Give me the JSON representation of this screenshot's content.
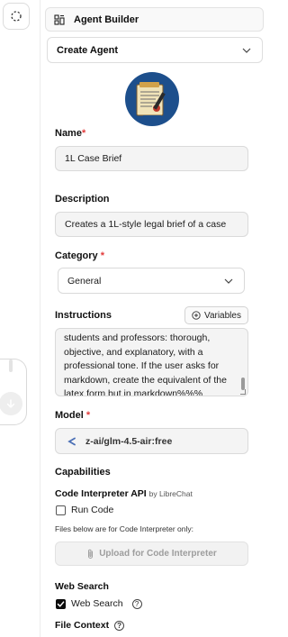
{
  "header": {
    "title": "Agent Builder"
  },
  "agent_select": {
    "value": "Create Agent"
  },
  "avatar": {
    "alt": "CASE BRIEF"
  },
  "name": {
    "label": "Name",
    "required_mark": "*",
    "value": "1L Case Brief"
  },
  "description": {
    "label": "Description",
    "value": "Creates a 1L-style legal brief of a case"
  },
  "category": {
    "label": "Category",
    "required_mark": "*",
    "value": "General"
  },
  "instructions": {
    "label": "Instructions",
    "variables_label": "Variables",
    "lines": [
      "students and professors: thorough,",
      "objective, and explanatory, with a",
      "professional tone.  If the user asks for",
      "markdown, create the equivalent of the",
      "latex form but in markdown%%%"
    ]
  },
  "model": {
    "label": "Model",
    "required_mark": "*",
    "value": "z-ai/glm-4.5-air:free"
  },
  "capabilities": {
    "label": "Capabilities",
    "code_interpreter": {
      "title": "Code Interpreter API",
      "by": "by LibreChat",
      "run_code_label": "Run Code",
      "run_code_checked": false,
      "files_note": "Files below are for Code Interpreter only:",
      "upload_label": "Upload for Code Interpreter"
    },
    "web_search": {
      "title": "Web Search",
      "checkbox_label": "Web Search",
      "checked": true
    },
    "file_context": {
      "title": "File Context"
    }
  }
}
